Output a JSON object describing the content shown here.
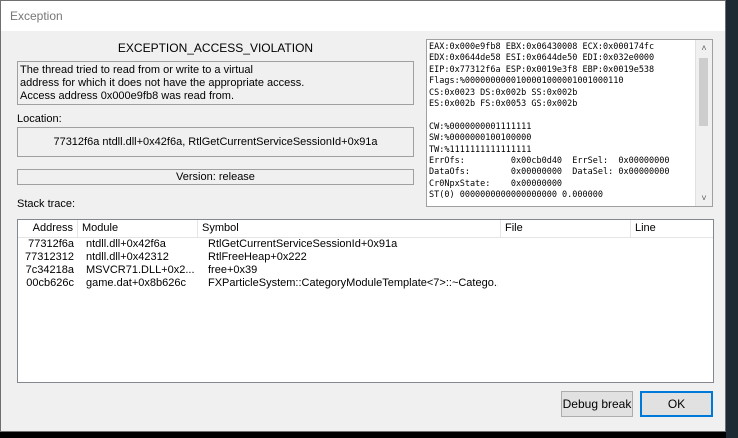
{
  "window": {
    "title": "Exception"
  },
  "exception": {
    "name": "EXCEPTION_ACCESS_VIOLATION",
    "message_lines": [
      "The thread tried to read from or write to a virtual",
      "address for which it does not have the appropriate access.",
      "Access address 0x000e9fb8 was read from."
    ]
  },
  "location": {
    "label": "Location:",
    "value": "77312f6a ntdll.dll+0x42f6a, RtlGetCurrentServiceSessionId+0x91a"
  },
  "version": {
    "value": "Version: release"
  },
  "registers": {
    "lines": [
      "EAX:0x000e9fb8 EBX:0x06430008 ECX:0x000174fc",
      "EDX:0x0644de58 ESI:0x0644de50 EDI:0x032e0000",
      "EIP:0x77312f6a ESP:0x0019e3f8 EBP:0x0019e538",
      "Flags:%0000000000100001000001001000110",
      "CS:0x0023 DS:0x002b SS:0x002b",
      "ES:0x002b FS:0x0053 GS:0x002b",
      "",
      "CW:%0000000001111111",
      "SW:%0000000100100000",
      "TW:%1111111111111111",
      "ErrOfs:         0x00cb0d40  ErrSel:  0x00000000",
      "DataOfs:        0x00000000  DataSel: 0x00000000",
      "Cr0NpxState:    0x00000000",
      "ST(0) 0000000000000000000 0.000000"
    ]
  },
  "stack_trace": {
    "label": "Stack trace:",
    "columns": [
      "Address",
      "Module",
      "Symbol",
      "File",
      "Line"
    ],
    "rows": [
      {
        "address": "77312f6a",
        "module": "ntdll.dll+0x42f6a",
        "symbol": "RtlGetCurrentServiceSessionId+0x91a",
        "file": "",
        "line": ""
      },
      {
        "address": "77312312",
        "module": "ntdll.dll+0x42312",
        "symbol": "RtlFreeHeap+0x222",
        "file": "",
        "line": ""
      },
      {
        "address": "7c34218a",
        "module": "MSVCR71.DLL+0x2...",
        "symbol": "free+0x39",
        "file": "",
        "line": ""
      },
      {
        "address": "00cb626c",
        "module": "game.dat+0x8b626c",
        "symbol": "FXParticleSystem::CategoryModuleTemplate<7>::~Catego...",
        "file": "",
        "line": ""
      }
    ]
  },
  "buttons": {
    "debug_break": "Debug break",
    "ok": "OK"
  },
  "icons": {
    "scroll_up": "chevron-up-icon",
    "scroll_down": "chevron-down-icon"
  }
}
